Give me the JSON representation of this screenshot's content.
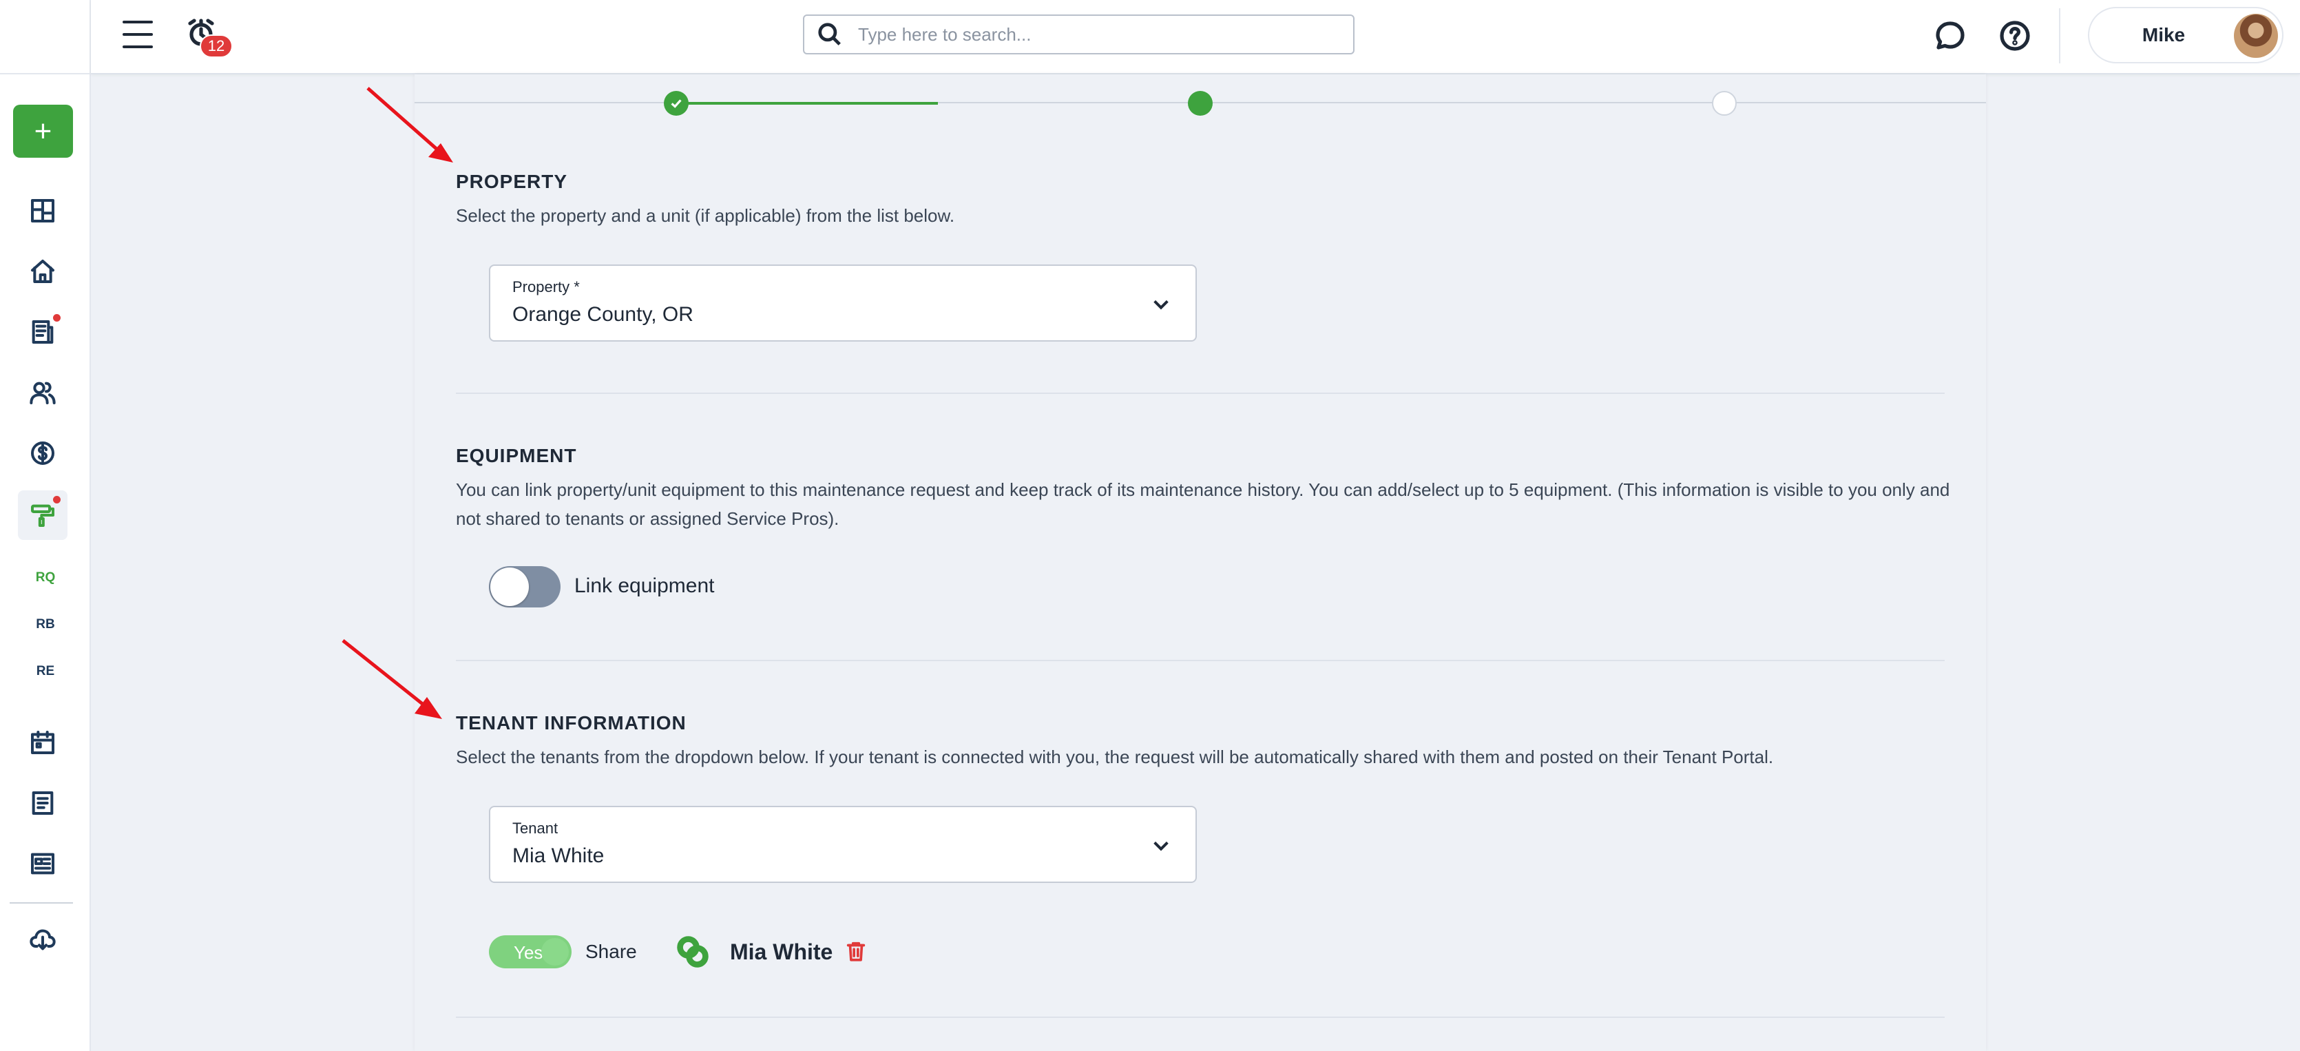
{
  "topbar": {
    "notification_count": "12",
    "search_placeholder": "Type here to search...",
    "user_name": "Mike"
  },
  "sidebar": {
    "add_label": "+",
    "sub_items": [
      "RQ",
      "RB",
      "RE"
    ]
  },
  "sections": {
    "property": {
      "title": "PROPERTY",
      "description": "Select the property and a unit (if applicable) from the list below.",
      "field_label": "Property *",
      "field_value": "Orange County, OR"
    },
    "equipment": {
      "title": "EQUIPMENT",
      "description": "You can link property/unit equipment to this maintenance request and keep track of its maintenance history. You can add/select up to 5 equipment. (This information is visible to you only and not shared to tenants or assigned Service Pros).",
      "toggle_label": "Link equipment"
    },
    "tenant": {
      "title": "TENANT INFORMATION",
      "description": "Select the tenants from the dropdown below. If your tenant is connected with you, the request will be automatically shared with them and posted on their Tenant Portal.",
      "field_label": "Tenant",
      "field_value": "Mia White",
      "share_toggle": "Yes",
      "share_label": "Share",
      "selected_tenant": "Mia White"
    }
  },
  "colors": {
    "accent": "#3ea33e",
    "alert": "#e03a3a",
    "annotation_arrow": "#e8141c"
  }
}
